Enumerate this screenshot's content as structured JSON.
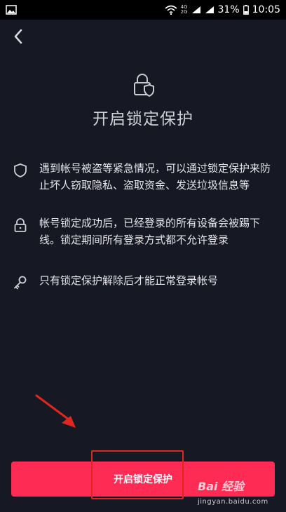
{
  "status_bar": {
    "net_top": "4G",
    "net_bottom": "2G",
    "battery": "31%",
    "time": "10:05"
  },
  "page": {
    "title": "开启锁定保护"
  },
  "items": [
    {
      "icon": "shield-icon",
      "text": "遇到帐号被盗等紧急情况，可以通过锁定保护来防止坏人窃取隐私、盗取资金、发送垃圾信息等"
    },
    {
      "icon": "lock-icon",
      "text": "帐号锁定成功后，已经登录的所有设备会被踢下线。锁定期间所有登录方式都不允许登录"
    },
    {
      "icon": "key-icon",
      "text": "只有锁定保护解除后才能正常登录帐号"
    }
  ],
  "button": {
    "label": "开启锁定保护"
  },
  "colors": {
    "background": "#161823",
    "accent": "#fe2c55",
    "annotation": "#e0271d"
  },
  "watermark": {
    "logo": "Bai 经验",
    "url": "jingyan.baidu.com"
  }
}
